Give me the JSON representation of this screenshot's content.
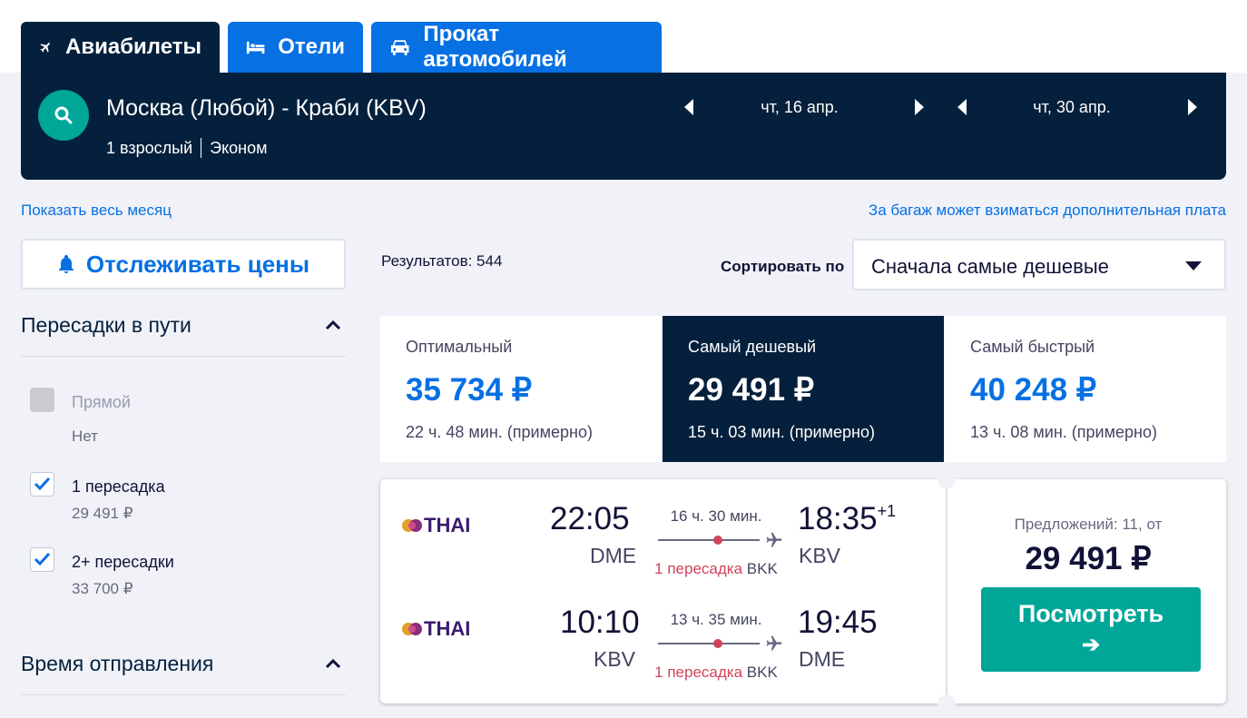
{
  "tabs": [
    {
      "label": "Авиабилеты",
      "icon": "plane-icon"
    },
    {
      "label": "Отели",
      "icon": "bed-icon"
    },
    {
      "label": "Прокат автомобилей",
      "icon": "car-icon"
    }
  ],
  "search": {
    "route": "Москва (Любой) - Краби (KBV)",
    "passengers": "1 взрослый",
    "cabin": "Эконом",
    "depart_date": "чт, 16 апр.",
    "return_date": "чт, 30 апр."
  },
  "links": {
    "whole_month": "Показать весь месяц",
    "baggage": "За багаж может взиматься дополнительная плата"
  },
  "track_prices": "Отслеживать цены",
  "filters": {
    "stops_title": "Пересадки в пути",
    "stops": [
      {
        "label": "Прямой",
        "price": "Нет",
        "checked": false,
        "disabled": true
      },
      {
        "label": "1 пересадка",
        "price": "29 491 ₽",
        "checked": true,
        "disabled": false
      },
      {
        "label": "2+ пересадки",
        "price": "33 700 ₽",
        "checked": true,
        "disabled": false
      }
    ],
    "departure_title": "Время отправления"
  },
  "results_text": "Результатов: 544",
  "sort": {
    "label": "Сортировать по",
    "value": "Сначала самые дешевые"
  },
  "summary": [
    {
      "title": "Оптимальный",
      "price": "35 734 ₽",
      "duration": "22 ч. 48 мин. (примерно)",
      "selected": false
    },
    {
      "title": "Самый дешевый",
      "price": "29 491 ₽",
      "duration": "15 ч. 03 мин. (примерно)",
      "selected": true
    },
    {
      "title": "Самый быстрый",
      "price": "40 248 ₽",
      "duration": "13 ч. 08 мин. (примерно)",
      "selected": false
    }
  ],
  "result": {
    "legs": [
      {
        "airline": "THAI",
        "dep_time": "22:05",
        "dep_airport": "DME",
        "duration": "16 ч. 30 мин.",
        "stops": "1 пересадка",
        "via": "BKK",
        "arr_time": "18:35",
        "arr_day": "+1",
        "arr_airport": "KBV"
      },
      {
        "airline": "THAI",
        "dep_time": "10:10",
        "dep_airport": "KBV",
        "duration": "13 ч. 35 мин.",
        "stops": "1 пересадка",
        "via": "BKK",
        "arr_time": "19:45",
        "arr_day": "",
        "arr_airport": "DME"
      }
    ],
    "offers": "Предложений: 11, от",
    "price": "29 491 ₽",
    "button": "Посмотреть",
    "button_arrow": "➔"
  },
  "colors": {
    "navy": "#05203c",
    "blue": "#0770e3",
    "teal": "#00a698",
    "stop_red": "#d1435b"
  }
}
